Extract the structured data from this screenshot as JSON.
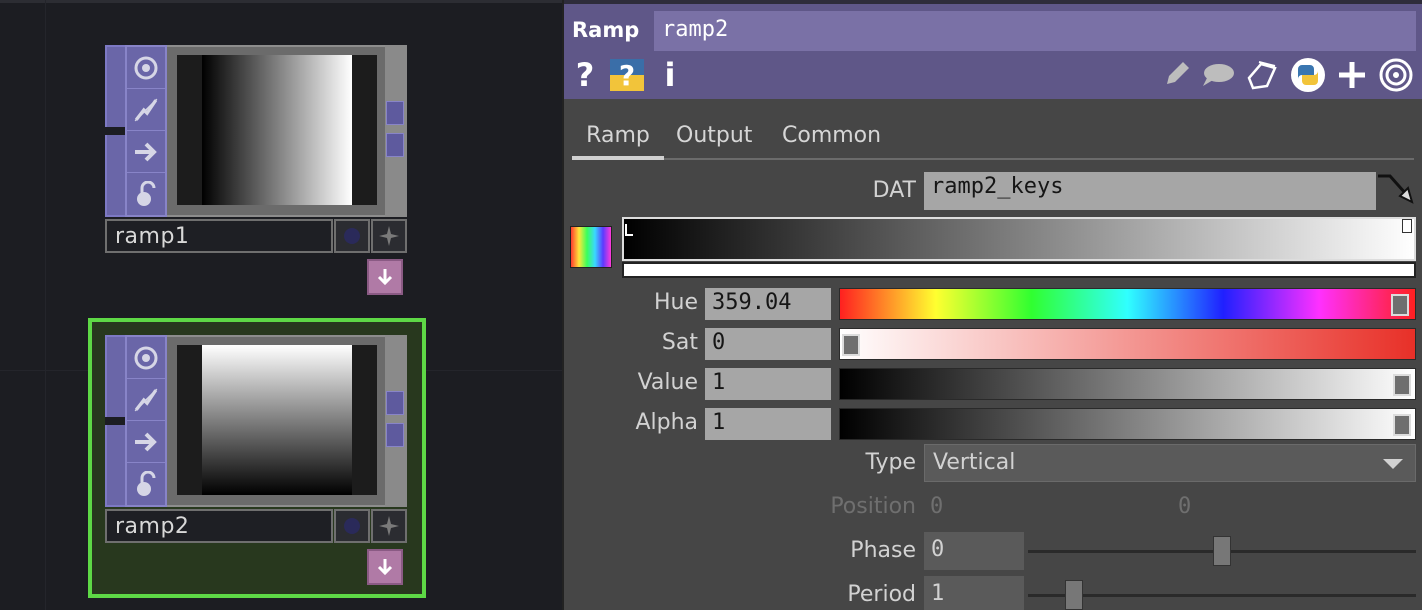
{
  "network": {
    "nodes": [
      {
        "name": "ramp1",
        "ramp_direction": "horizontal",
        "selected": false
      },
      {
        "name": "ramp2",
        "ramp_direction": "vertical",
        "selected": true
      }
    ]
  },
  "panel": {
    "op_type": "Ramp",
    "op_name": "ramp2",
    "header_icons": [
      "help-icon",
      "python-help-icon",
      "info-icon",
      "edit-icon",
      "comment-icon",
      "clone-icon",
      "python-icon",
      "add-icon",
      "target-icon"
    ],
    "help_glyph": "?",
    "info_glyph": "i",
    "tabs": [
      {
        "label": "Ramp",
        "active": true
      },
      {
        "label": "Output",
        "active": false
      },
      {
        "label": "Common",
        "active": false
      }
    ],
    "dat": {
      "label": "DAT",
      "value": "ramp2_keys"
    },
    "hue": {
      "label": "Hue",
      "value": "359.04",
      "level": 0.997
    },
    "sat": {
      "label": "Sat",
      "value": "0",
      "level": 0.0
    },
    "value": {
      "label": "Value",
      "value": "1",
      "level": 1.0
    },
    "alpha": {
      "label": "Alpha",
      "value": "1",
      "level": 1.0
    },
    "type": {
      "label": "Type",
      "value": "Vertical"
    },
    "position": {
      "label": "Position",
      "x": "0",
      "y": "0"
    },
    "phase": {
      "label": "Phase",
      "value": "0",
      "level": 0.5
    },
    "period": {
      "label": "Period",
      "value": "1",
      "level": 0.1
    }
  },
  "colors": {
    "header": "#5f5788",
    "node_purple": "#6a66a8",
    "selection": "#5ed846",
    "panel_bg": "#464646"
  }
}
